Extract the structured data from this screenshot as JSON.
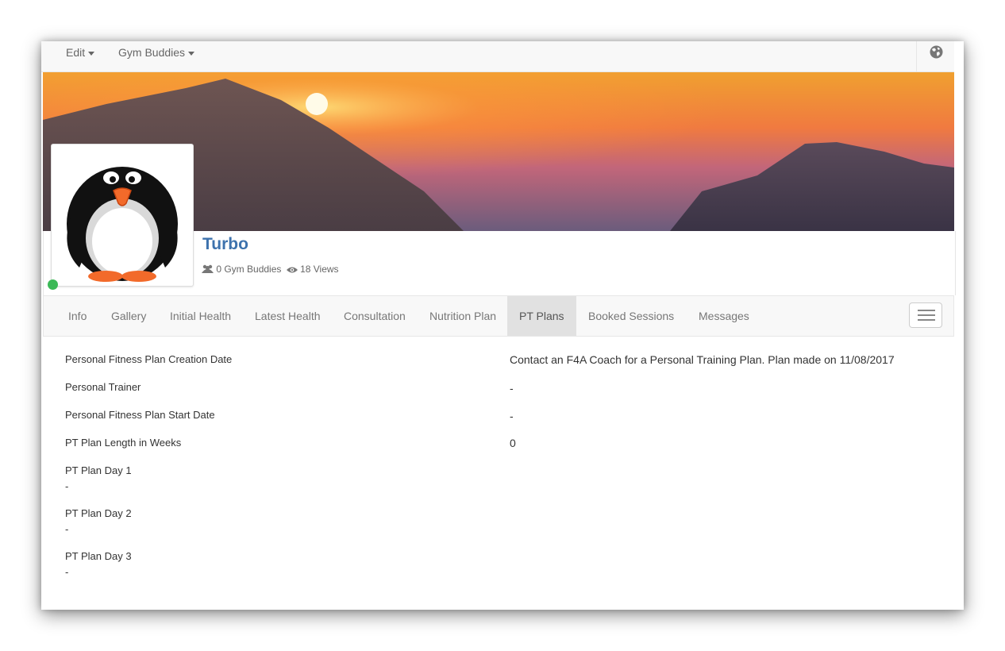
{
  "navbar": {
    "menu": [
      {
        "label": "Edit"
      },
      {
        "label": "Gym Buddies"
      }
    ],
    "globe_icon": "globe-icon"
  },
  "profile": {
    "name": "Turbo",
    "buddies": "0 Gym Buddies",
    "views": "18 Views",
    "online_color": "#3cb957",
    "name_color": "#3d72ad"
  },
  "tabs": [
    {
      "label": "Info"
    },
    {
      "label": "Gallery"
    },
    {
      "label": "Initial Health"
    },
    {
      "label": "Latest Health"
    },
    {
      "label": "Consultation"
    },
    {
      "label": "Nutrition Plan"
    },
    {
      "label": "PT Plans",
      "active": true
    },
    {
      "label": "Booked Sessions"
    },
    {
      "label": "Messages"
    }
  ],
  "fields": [
    {
      "label": "Personal Fitness Plan Creation Date",
      "value": "Contact an F4A Coach for a Personal Training Plan. Plan made on 11/08/2017"
    },
    {
      "label": "Personal Trainer",
      "value": "-"
    },
    {
      "label": "Personal Fitness Plan Start Date",
      "value": "-"
    },
    {
      "label": "PT Plan Length in Weeks",
      "value": "0"
    }
  ],
  "days": [
    {
      "label": "PT Plan Day 1",
      "value": "-"
    },
    {
      "label": "PT Plan Day 2",
      "value": "-"
    },
    {
      "label": "PT Plan Day 3",
      "value": "-"
    }
  ]
}
